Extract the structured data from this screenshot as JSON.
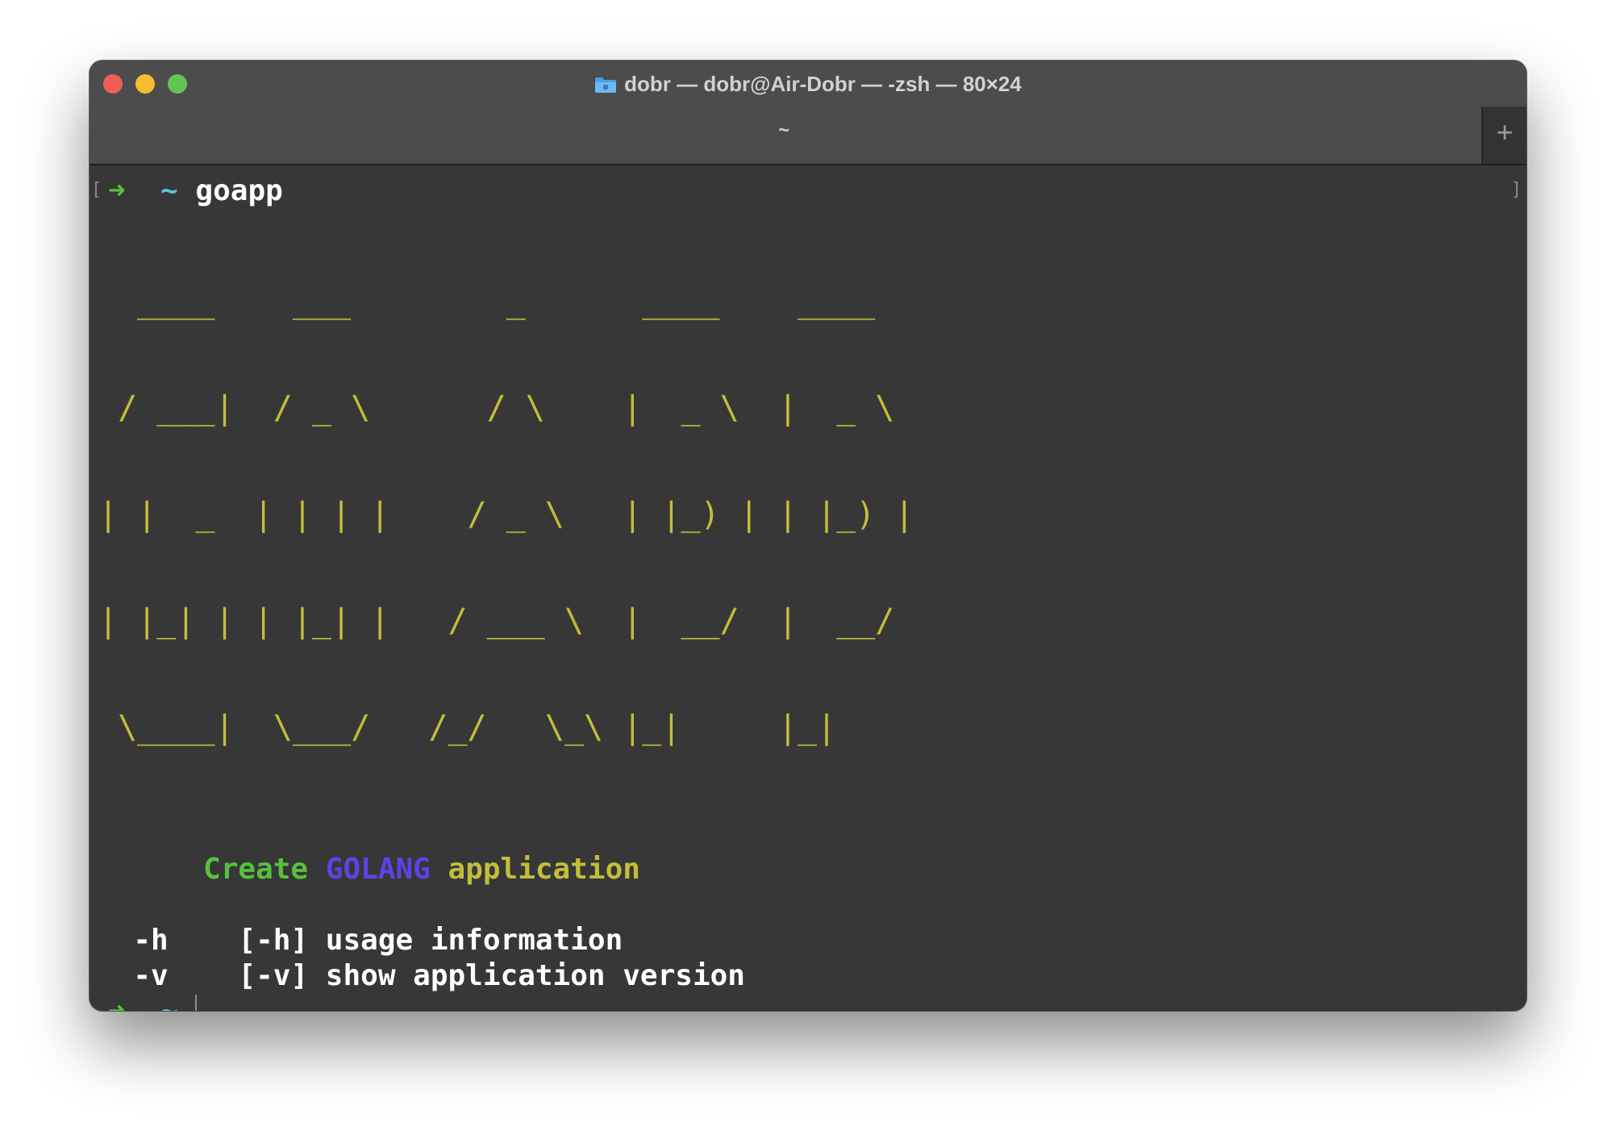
{
  "window": {
    "title": "dobr — dobr@Air-Dobr — -zsh — 80×24",
    "tab_label": "~",
    "new_tab_label": "+",
    "title_icon": "folder-icon"
  },
  "terminal": {
    "prompt_arrow": "➜",
    "prompt_dir": "~",
    "command": "goapp",
    "ascii_art": [
      "  ____    ___        _      ____    ____",
      " / ___|  / _ \\      / \\    |  _ \\  |  _ \\",
      "| |  _  | | | |    / _ \\   | |_) | | |_) |",
      "| |_| | | |_| |   / ___ \\  |  __/  |  __/",
      " \\____|  \\___/   /_/   \\_\\ |_|     |_|"
    ],
    "tagline": {
      "create": "Create",
      "golang": "GOLANG",
      "application": "application"
    },
    "options": [
      {
        "flag": "-h",
        "desc": "[-h] usage information"
      },
      {
        "flag": "-v",
        "desc": "[-v] show application version"
      }
    ],
    "colors": {
      "background": "#373737",
      "arrow": "#57c13f",
      "tilde": "#58c4d8",
      "ascii": "#c4bd3a",
      "golang": "#5b44e6"
    }
  }
}
